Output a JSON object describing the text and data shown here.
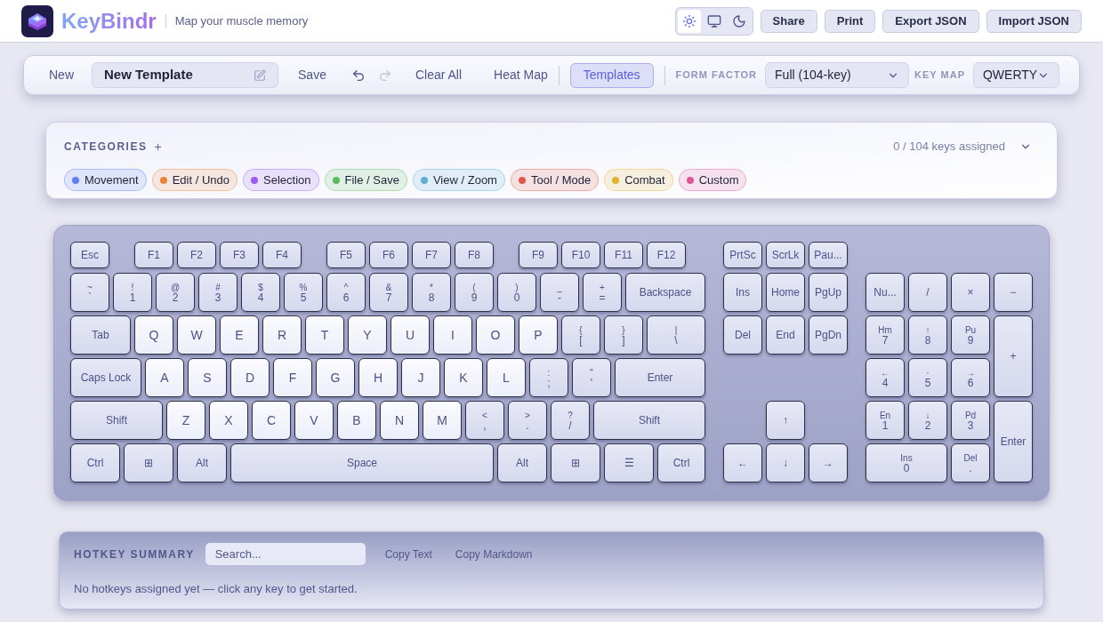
{
  "header": {
    "brand": "KeyBindr",
    "tagline": "Map your muscle memory",
    "theme_modes": [
      {
        "kind": "light",
        "selected": true
      },
      {
        "kind": "system",
        "selected": false
      },
      {
        "kind": "dark",
        "selected": false
      }
    ],
    "buttons": [
      "Share",
      "Print",
      "Export JSON",
      "Import JSON"
    ]
  },
  "toolbar": {
    "new": "New",
    "template_name": "New Template",
    "save": "Save",
    "undo": {
      "disabled": false
    },
    "redo": {
      "disabled": true
    },
    "clear_all": "Clear All",
    "heat_map": "Heat Map",
    "templates": {
      "label": "Templates",
      "selected": true
    },
    "form_factor": {
      "label": "FORM FACTOR",
      "value": "Full (104-key)"
    },
    "key_map": {
      "label": "KEY MAP",
      "value": "QWERTY"
    }
  },
  "categories": {
    "title": "CATEGORIES",
    "add": "+",
    "assigned": "0 / 104 keys assigned",
    "items": [
      {
        "label": "Movement",
        "color": "#5b7ff0"
      },
      {
        "label": "Edit / Undo",
        "color": "#e8833a"
      },
      {
        "label": "Selection",
        "color": "#9b5cf0"
      },
      {
        "label": "File / Save",
        "color": "#5cbd5c"
      },
      {
        "label": "View / Zoom",
        "color": "#5aaed6"
      },
      {
        "label": "Tool / Mode",
        "color": "#e05a48"
      },
      {
        "label": "Combat",
        "color": "#e3b22e"
      },
      {
        "label": "Custom",
        "color": "#e0559a"
      }
    ]
  },
  "keyboard": {
    "fn_groups": [
      [
        {
          "label": "Esc"
        }
      ],
      [
        {
          "label": "F1"
        },
        {
          "label": "F2"
        },
        {
          "label": "F3"
        },
        {
          "label": "F4"
        }
      ],
      [
        {
          "label": "F5"
        },
        {
          "label": "F6"
        },
        {
          "label": "F7"
        },
        {
          "label": "F8"
        }
      ],
      [
        {
          "label": "F9"
        },
        {
          "label": "F10"
        },
        {
          "label": "F11"
        },
        {
          "label": "F12"
        }
      ]
    ],
    "main_rows": [
      [
        {
          "label": "`",
          "sub": "~",
          "kind": "key"
        },
        {
          "label": "1",
          "sub": "!",
          "kind": "key"
        },
        {
          "label": "2",
          "sub": "@",
          "kind": "key"
        },
        {
          "label": "3",
          "sub": "#",
          "kind": "key"
        },
        {
          "label": "4",
          "sub": "$",
          "kind": "key"
        },
        {
          "label": "5",
          "sub": "%",
          "kind": "key"
        },
        {
          "label": "6",
          "sub": "^",
          "kind": "key"
        },
        {
          "label": "7",
          "sub": "&",
          "kind": "key"
        },
        {
          "label": "8",
          "sub": "*",
          "kind": "key"
        },
        {
          "label": "9",
          "sub": "(",
          "kind": "key"
        },
        {
          "label": "0",
          "sub": ")",
          "kind": "key"
        },
        {
          "label": "-",
          "sub": "_",
          "kind": "key"
        },
        {
          "label": "=",
          "sub": "+",
          "kind": "key"
        },
        {
          "label": "Backspace",
          "kind": "key"
        }
      ],
      [
        {
          "label": "Tab",
          "kind": "tab"
        },
        {
          "label": "Q",
          "kind": "letter"
        },
        {
          "label": "W",
          "kind": "letter"
        },
        {
          "label": "E",
          "kind": "letter"
        },
        {
          "label": "R",
          "kind": "letter"
        },
        {
          "label": "T",
          "kind": "letter"
        },
        {
          "label": "Y",
          "kind": "letter"
        },
        {
          "label": "U",
          "kind": "letter"
        },
        {
          "label": "I",
          "kind": "letter"
        },
        {
          "label": "O",
          "kind": "letter"
        },
        {
          "label": "P",
          "kind": "letter"
        },
        {
          "label": "[",
          "sub": "{",
          "kind": "key"
        },
        {
          "label": "]",
          "sub": "}",
          "kind": "key"
        },
        {
          "label": "\\",
          "sub": "|",
          "kind": "key"
        }
      ],
      [
        {
          "label": "Caps Lock",
          "kind": "caps"
        },
        {
          "label": "A",
          "kind": "letter"
        },
        {
          "label": "S",
          "kind": "letter"
        },
        {
          "label": "D",
          "kind": "letter"
        },
        {
          "label": "F",
          "kind": "letter"
        },
        {
          "label": "G",
          "kind": "letter"
        },
        {
          "label": "H",
          "kind": "letter"
        },
        {
          "label": "J",
          "kind": "letter"
        },
        {
          "label": "K",
          "kind": "letter"
        },
        {
          "label": "L",
          "kind": "letter"
        },
        {
          "label": ";",
          "sub": ":",
          "kind": "key"
        },
        {
          "label": "'",
          "sub": "\"",
          "kind": "key"
        },
        {
          "label": "Enter",
          "kind": "key"
        }
      ],
      [
        {
          "label": "Shift",
          "kind": "shift"
        },
        {
          "label": "Z",
          "kind": "letter"
        },
        {
          "label": "X",
          "kind": "letter"
        },
        {
          "label": "C",
          "kind": "letter"
        },
        {
          "label": "V",
          "kind": "letter"
        },
        {
          "label": "B",
          "kind": "letter"
        },
        {
          "label": "N",
          "kind": "letter"
        },
        {
          "label": "M",
          "kind": "letter"
        },
        {
          "label": ",",
          "sub": "<",
          "kind": "key"
        },
        {
          "label": ".",
          "sub": ">",
          "kind": "key"
        },
        {
          "label": "/",
          "sub": "?",
          "kind": "key"
        },
        {
          "label": "Shift",
          "kind": "key"
        }
      ],
      [
        {
          "label": "Ctrl",
          "kind": "mod"
        },
        {
          "label": "⊞",
          "kind": "mod"
        },
        {
          "label": "Alt",
          "kind": "mod"
        },
        {
          "label": "Space",
          "kind": "space"
        },
        {
          "label": "Alt",
          "kind": "mod"
        },
        {
          "label": "⊞",
          "kind": "mod"
        },
        {
          "label": "☰",
          "kind": "mod"
        },
        {
          "label": "Ctrl",
          "kind": "mod"
        }
      ]
    ],
    "nav_fn": [
      {
        "label": "PrtSc"
      },
      {
        "label": "ScrLk"
      },
      {
        "label": "Pau..."
      }
    ],
    "nav_top": [
      [
        {
          "label": "Ins"
        },
        {
          "label": "Home"
        },
        {
          "label": "PgUp"
        }
      ],
      [
        {
          "label": "Del"
        },
        {
          "label": "End"
        },
        {
          "label": "PgDn"
        }
      ]
    ],
    "nav_arrows": [
      [
        {
          "label": "↑"
        }
      ],
      [
        {
          "label": "←"
        },
        {
          "label": "↓"
        },
        {
          "label": "→"
        }
      ]
    ],
    "numpad": [
      {
        "label": "Nu...",
        "kind": "key"
      },
      {
        "label": "/",
        "kind": "key"
      },
      {
        "label": "×",
        "kind": "key"
      },
      {
        "label": "−",
        "kind": "key"
      },
      {
        "label": "7",
        "sub": "Hm",
        "kind": "key"
      },
      {
        "label": "8",
        "sub": "↑",
        "kind": "key"
      },
      {
        "label": "9",
        "sub": "Pu",
        "kind": "key"
      },
      {
        "label": "+",
        "kind": "tall"
      },
      {
        "label": "4",
        "sub": "←",
        "kind": "key"
      },
      {
        "label": "5",
        "sub": "·",
        "kind": "key"
      },
      {
        "label": "6",
        "sub": "→",
        "kind": "key"
      },
      {
        "label": "1",
        "sub": "En",
        "kind": "key"
      },
      {
        "label": "2",
        "sub": "↓",
        "kind": "key"
      },
      {
        "label": "3",
        "sub": "Pd",
        "kind": "key"
      },
      {
        "label": "Enter",
        "kind": "tall"
      },
      {
        "label": "0",
        "sub": "Ins",
        "kind": "double"
      },
      {
        "label": ".",
        "sub": "Del",
        "kind": "key"
      }
    ]
  },
  "summary": {
    "title": "HOTKEY SUMMARY",
    "search_placeholder": "Search...",
    "actions": [
      "Copy Text",
      "Copy Markdown"
    ],
    "empty_message": "No hotkeys assigned yet — click any key to get started."
  }
}
